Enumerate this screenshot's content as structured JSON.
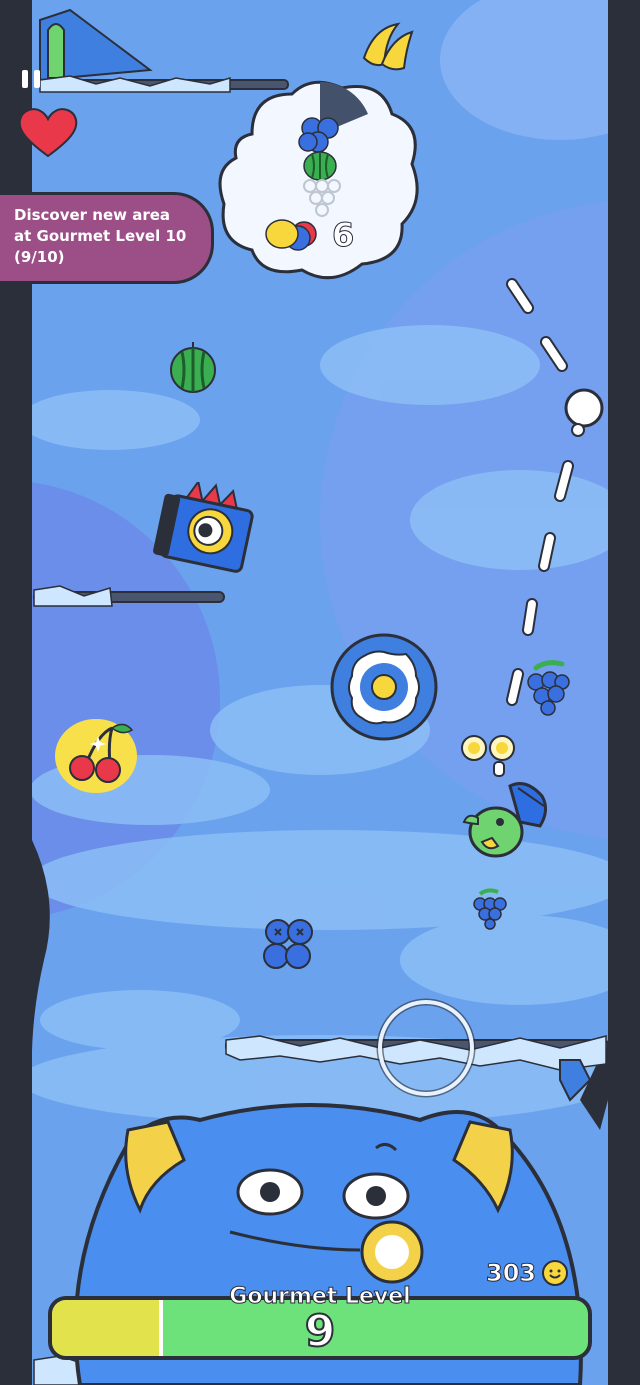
{
  "hud": {
    "lives": 1,
    "gourmet_title": "Gourmet Level",
    "gourmet_level": "9",
    "gourmet_progress": 0.2,
    "coins": "303"
  },
  "banner": {
    "line1": "Discover new area",
    "line2": "at Gourmet Level 10",
    "line3": "(9/10)"
  },
  "recipe": {
    "count": "6",
    "timer_fraction": 0.2
  },
  "colors": {
    "sky": "#6aa2ee",
    "platform_ice": "#cfe6ff",
    "monster_blue": "#4a8ef0",
    "ear_yellow": "#f3d24a",
    "gauge_green": "#6ee27a",
    "gauge_yellow": "#e2e24c",
    "banner_purple": "#9c4f87",
    "heart_red": "#e8384a"
  },
  "items": [
    {
      "name": "banana-icon"
    },
    {
      "name": "watermelon-icon"
    },
    {
      "name": "cherry-icon"
    },
    {
      "name": "grapes-icon"
    },
    {
      "name": "blueberries-icon"
    }
  ]
}
